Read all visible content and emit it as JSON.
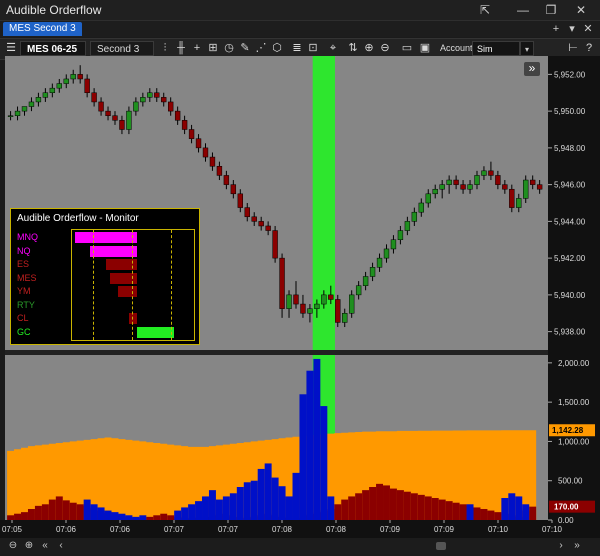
{
  "window": {
    "title": "Audible Orderflow",
    "tab_label": "MES Second 3",
    "controls": [
      "⇱",
      "—",
      "❐",
      "✕"
    ],
    "tab_controls": [
      "+",
      "▾",
      "✕"
    ]
  },
  "toolbar": {
    "instrument": "MES 06-25",
    "period": "Second 3",
    "tools": [
      "bar-chart-icon",
      "crosshair-icon",
      "zoom-icon",
      "clock-icon",
      "pencil-icon",
      "trend-icon",
      "cube-icon",
      "list-icon",
      "rank-icon",
      "zoom-in-icon",
      "zoom-out-icon",
      "properties-icon",
      "save-icon"
    ],
    "account_label": "Account:",
    "account_value": "Sim Default",
    "dropdown_arrow": "▾",
    "help_icon": "?"
  },
  "monitor": {
    "title": "Audible Orderflow - Monitor",
    "rows": [
      {
        "name": "MNQ",
        "value": -50,
        "color": "#ff00ff"
      },
      {
        "name": "NQ",
        "value": -38,
        "color": "#ff00ff"
      },
      {
        "name": "ES",
        "value": -25,
        "color": "#8b0000"
      },
      {
        "name": "MES",
        "value": -22,
        "color": "#8b0000"
      },
      {
        "name": "YM",
        "value": -15,
        "color": "#8b0000"
      },
      {
        "name": "RTY",
        "value": 0,
        "color": "#228b22"
      },
      {
        "name": "CL",
        "value": -6,
        "color": "#8b0000"
      },
      {
        "name": "GC",
        "value": 30,
        "color": "#22ee22"
      }
    ]
  },
  "price_axis": [
    "5,952.00",
    "5,950.00",
    "5,948.00",
    "5,946.00",
    "5,944.00",
    "5,942.00",
    "5,940.00",
    "5,938.00"
  ],
  "volume_axis": [
    "2,000.00",
    "1,500.00",
    "1,000.00",
    "500.00",
    "0.00"
  ],
  "markers": {
    "volume_avg": "1,142.28",
    "last_volume": "170.00"
  },
  "time_axis": [
    "07:05",
    "07:06",
    "07:06",
    "07:07",
    "07:07",
    "07:08",
    "07:08",
    "07:09",
    "07:09",
    "07:10",
    "07:10"
  ],
  "expand_icon": "»",
  "scroll_icons": [
    "⊖",
    "⊕",
    "«",
    "‹",
    "›",
    "»"
  ],
  "chart_data": [
    {
      "type": "candlestick",
      "title": "",
      "ylim": [
        5937,
        5953
      ],
      "highlight_x": 46,
      "candles": [
        [
          5949.75,
          5950.0,
          5949.5,
          5949.75
        ],
        [
          5949.75,
          5950.25,
          5949.5,
          5950.0
        ],
        [
          5950.0,
          5950.25,
          5949.75,
          5950.25
        ],
        [
          5950.25,
          5950.75,
          5950.0,
          5950.5
        ],
        [
          5950.5,
          5951.0,
          5950.25,
          5950.75
        ],
        [
          5950.75,
          5951.25,
          5950.5,
          5951.0
        ],
        [
          5951.0,
          5951.5,
          5950.75,
          5951.25
        ],
        [
          5951.25,
          5951.75,
          5951.0,
          5951.5
        ],
        [
          5951.5,
          5952.0,
          5951.25,
          5951.75
        ],
        [
          5951.75,
          5952.25,
          5951.5,
          5952.0
        ],
        [
          5952.0,
          5952.5,
          5951.5,
          5951.75
        ],
        [
          5951.75,
          5952.0,
          5950.75,
          5951.0
        ],
        [
          5951.0,
          5951.25,
          5950.25,
          5950.5
        ],
        [
          5950.5,
          5950.75,
          5949.75,
          5950.0
        ],
        [
          5950.0,
          5950.25,
          5949.5,
          5949.75
        ],
        [
          5949.75,
          5950.0,
          5949.25,
          5949.5
        ],
        [
          5949.5,
          5949.75,
          5948.75,
          5949.0
        ],
        [
          5949.0,
          5950.25,
          5948.75,
          5950.0
        ],
        [
          5950.0,
          5950.75,
          5949.75,
          5950.5
        ],
        [
          5950.5,
          5951.0,
          5950.25,
          5950.75
        ],
        [
          5950.75,
          5951.25,
          5950.5,
          5951.0
        ],
        [
          5951.0,
          5951.25,
          5950.5,
          5950.75
        ],
        [
          5950.75,
          5951.0,
          5950.25,
          5950.5
        ],
        [
          5950.5,
          5950.75,
          5949.75,
          5950.0
        ],
        [
          5950.0,
          5950.25,
          5949.25,
          5949.5
        ],
        [
          5949.5,
          5949.75,
          5948.75,
          5949.0
        ],
        [
          5949.0,
          5949.25,
          5948.25,
          5948.5
        ],
        [
          5948.5,
          5948.75,
          5947.75,
          5948.0
        ],
        [
          5948.0,
          5948.25,
          5947.25,
          5947.5
        ],
        [
          5947.5,
          5947.75,
          5946.75,
          5947.0
        ],
        [
          5947.0,
          5947.25,
          5946.25,
          5946.5
        ],
        [
          5946.5,
          5946.75,
          5945.75,
          5946.0
        ],
        [
          5946.0,
          5946.25,
          5945.25,
          5945.5
        ],
        [
          5945.5,
          5945.75,
          5944.5,
          5944.75
        ],
        [
          5944.75,
          5945.0,
          5944.0,
          5944.25
        ],
        [
          5944.25,
          5944.5,
          5943.75,
          5944.0
        ],
        [
          5944.0,
          5944.25,
          5943.5,
          5943.75
        ],
        [
          5943.75,
          5944.0,
          5943.25,
          5943.5
        ],
        [
          5943.5,
          5943.75,
          5941.75,
          5942.0
        ],
        [
          5942.0,
          5942.25,
          5938.75,
          5939.25
        ],
        [
          5939.25,
          5940.25,
          5938.75,
          5940.0
        ],
        [
          5940.0,
          5940.75,
          5939.25,
          5939.5
        ],
        [
          5939.5,
          5940.0,
          5938.75,
          5939.0
        ],
        [
          5939.0,
          5939.5,
          5938.5,
          5939.25
        ],
        [
          5939.25,
          5939.75,
          5938.75,
          5939.5
        ],
        [
          5939.5,
          5940.25,
          5939.25,
          5940.0
        ],
        [
          5940.0,
          5940.5,
          5939.5,
          5939.75
        ],
        [
          5939.75,
          5940.0,
          5938.25,
          5938.5
        ],
        [
          5938.5,
          5939.25,
          5938.25,
          5939.0
        ],
        [
          5939.0,
          5940.25,
          5938.75,
          5940.0
        ],
        [
          5940.0,
          5940.75,
          5939.75,
          5940.5
        ],
        [
          5940.5,
          5941.25,
          5940.25,
          5941.0
        ],
        [
          5941.0,
          5941.75,
          5940.75,
          5941.5
        ],
        [
          5941.5,
          5942.25,
          5941.25,
          5942.0
        ],
        [
          5942.0,
          5942.75,
          5941.75,
          5942.5
        ],
        [
          5942.5,
          5943.25,
          5942.25,
          5943.0
        ],
        [
          5943.0,
          5943.75,
          5942.75,
          5943.5
        ],
        [
          5943.5,
          5944.25,
          5943.25,
          5944.0
        ],
        [
          5944.0,
          5944.75,
          5943.75,
          5944.5
        ],
        [
          5944.5,
          5945.25,
          5944.25,
          5945.0
        ],
        [
          5945.0,
          5945.75,
          5944.75,
          5945.5
        ],
        [
          5945.5,
          5946.0,
          5945.25,
          5945.75
        ],
        [
          5945.75,
          5946.25,
          5945.25,
          5946.0
        ],
        [
          5946.0,
          5946.5,
          5945.5,
          5946.25
        ],
        [
          5946.25,
          5946.5,
          5945.75,
          5946.0
        ],
        [
          5946.0,
          5946.25,
          5945.5,
          5945.75
        ],
        [
          5945.75,
          5946.25,
          5945.5,
          5946.0
        ],
        [
          5946.0,
          5946.75,
          5945.75,
          5946.5
        ],
        [
          5946.5,
          5947.0,
          5946.25,
          5946.75
        ],
        [
          5946.75,
          5947.25,
          5946.25,
          5946.5
        ],
        [
          5946.5,
          5946.75,
          5945.75,
          5946.0
        ],
        [
          5946.0,
          5946.25,
          5945.5,
          5945.75
        ],
        [
          5945.75,
          5946.0,
          5944.5,
          5944.75
        ],
        [
          5944.75,
          5945.5,
          5944.5,
          5945.25
        ],
        [
          5945.25,
          5946.5,
          5945.0,
          5946.25
        ],
        [
          5946.25,
          5946.5,
          5945.75,
          5946.0
        ],
        [
          5946.0,
          5946.25,
          5945.5,
          5945.75
        ]
      ]
    },
    {
      "type": "volume",
      "ylim": [
        0,
        2100
      ],
      "buy_volume": [
        40,
        60,
        30,
        20,
        50,
        70,
        90,
        120,
        140,
        130,
        150,
        260,
        200,
        160,
        120,
        100,
        80,
        60,
        40,
        60,
        40,
        20,
        30,
        60,
        120,
        160,
        200,
        240,
        300,
        380,
        260,
        300,
        340,
        420,
        480,
        500,
        650,
        720,
        540,
        430,
        300,
        600,
        1600,
        1900,
        2050,
        1450,
        300,
        200,
        150,
        100,
        60,
        40,
        30,
        20,
        30,
        20,
        20,
        20,
        20,
        20,
        30,
        40,
        60,
        80,
        120,
        160,
        200,
        150,
        100,
        80,
        60,
        280,
        340,
        300,
        200,
        170
      ],
      "sell_volume": [
        60,
        80,
        100,
        140,
        180,
        200,
        260,
        300,
        250,
        220,
        200,
        180,
        150,
        120,
        90,
        60,
        40,
        30,
        20,
        30,
        40,
        60,
        80,
        60,
        40,
        30,
        20,
        30,
        40,
        60,
        80,
        60,
        40,
        30,
        20,
        40,
        60,
        80,
        60,
        40,
        30,
        20,
        60,
        80,
        100,
        120,
        140,
        200,
        260,
        300,
        340,
        380,
        420,
        460,
        440,
        400,
        380,
        360,
        340,
        320,
        300,
        280,
        260,
        240,
        220,
        200,
        180,
        160,
        140,
        120,
        100,
        80,
        60,
        40,
        120,
        170
      ],
      "avg_volume": [
        880,
        900,
        920,
        940,
        950,
        960,
        970,
        980,
        990,
        1000,
        1010,
        1020,
        1030,
        1040,
        1050,
        1040,
        1030,
        1020,
        1010,
        1000,
        990,
        980,
        970,
        960,
        950,
        940,
        930,
        930,
        930,
        940,
        950,
        960,
        970,
        980,
        990,
        1000,
        1010,
        1020,
        1030,
        1040,
        1050,
        1060,
        1070,
        1080,
        1090,
        1100,
        1100,
        1105,
        1110,
        1115,
        1120,
        1125,
        1125,
        1130,
        1130,
        1130,
        1135,
        1135,
        1135,
        1136,
        1136,
        1137,
        1138,
        1138,
        1139,
        1139,
        1140,
        1140,
        1141,
        1141,
        1141,
        1142,
        1142,
        1142,
        1142.28,
        1142.28
      ]
    }
  ]
}
